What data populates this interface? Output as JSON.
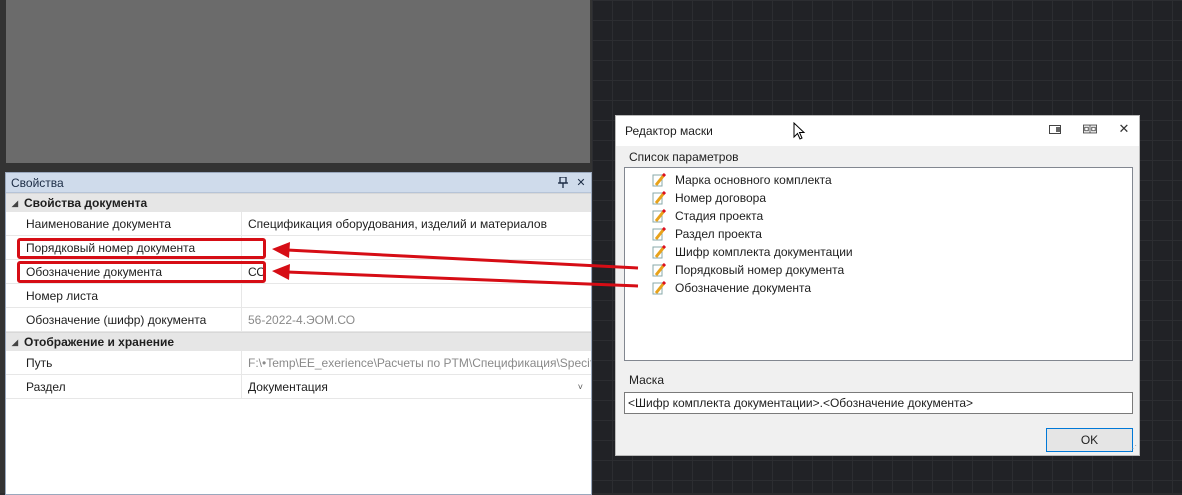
{
  "properties_panel": {
    "title": "Свойства",
    "pin_icon": "pin-icon",
    "close_icon": "close-icon",
    "categories": [
      {
        "label": "Свойства документа",
        "rows": [
          {
            "name": "Наименование документа",
            "value": "Спецификация оборудования, изделий и материалов",
            "muted": false
          },
          {
            "name": "Порядковый номер документа",
            "value": "",
            "muted": false
          },
          {
            "name": "Обозначение документа",
            "value": "СО",
            "muted": false
          },
          {
            "name": "Номер листа",
            "value": "",
            "muted": false
          },
          {
            "name": "Обозначение (шифр) документа",
            "value": "56-2022-4.ЭОМ.СО",
            "muted": true
          }
        ]
      },
      {
        "label": "Отображение и хранение",
        "rows": [
          {
            "name": "Путь",
            "value": "F:\\•Temp\\EE_exerience\\Расчеты по PTM\\Спецификация\\Specific...",
            "muted": true
          },
          {
            "name": "Раздел",
            "value": "Документация",
            "muted": false
          }
        ]
      }
    ]
  },
  "mask_editor": {
    "title": "Редактор маски",
    "param_group_label": "Список параметров",
    "params": [
      "Марка основного комплекта",
      "Номер договора",
      "Стадия проекта",
      "Раздел проекта",
      "Шифр комплекта документации",
      "Порядковый номер документа",
      "Обозначение документа"
    ],
    "mask_group_label": "Маска",
    "mask_value": "<Шифр комплекта документации>.<Обозначение документа>",
    "ok_label": "OK"
  },
  "colors": {
    "highlight": "#d60d15",
    "panel_header": "#cfdbeb",
    "canvas_bg": "#212226"
  }
}
